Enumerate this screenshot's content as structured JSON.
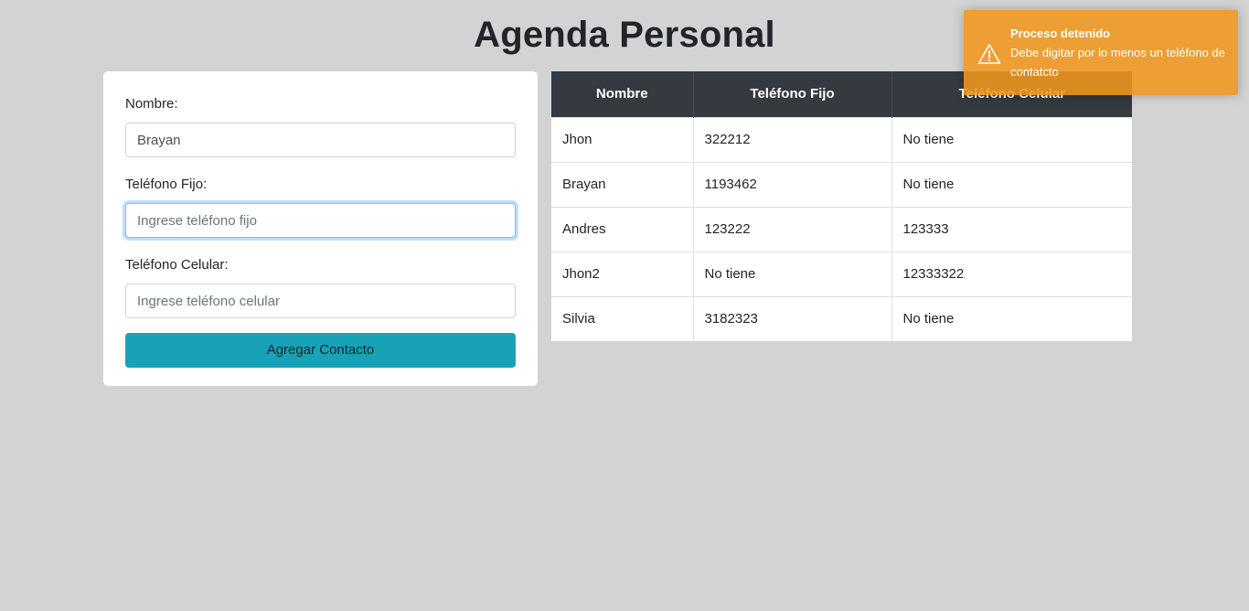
{
  "page": {
    "title": "Agenda Personal"
  },
  "form": {
    "name_label": "Nombre:",
    "name_value": "Brayan",
    "landline_label": "Teléfono Fijo:",
    "landline_placeholder": "Ingrese teléfono fijo",
    "mobile_label": "Teléfono Celular:",
    "mobile_placeholder": "Ingrese teléfono celular",
    "submit_label": "Agregar Contacto"
  },
  "table": {
    "headers": [
      "Nombre",
      "Teléfono Fijo",
      "Teléfono Celular"
    ],
    "rows": [
      [
        "Jhon",
        "322212",
        "No tiene"
      ],
      [
        "Brayan",
        "1193462",
        "No tiene"
      ],
      [
        "Andres",
        "123222",
        "123333"
      ],
      [
        "Jhon2",
        "No tiene",
        "12333322"
      ],
      [
        "Silvia",
        "3182323",
        "No tiene"
      ]
    ]
  },
  "toast": {
    "type": "warning",
    "icon": "warning-icon",
    "title": "Proceso detenido",
    "message": "Debe digitar por lo menos un teléfono de contatcto",
    "color": "#f0961e"
  },
  "colors": {
    "background": "#d3d3d3",
    "button": "#17a2b8",
    "table_header": "#343a40"
  }
}
